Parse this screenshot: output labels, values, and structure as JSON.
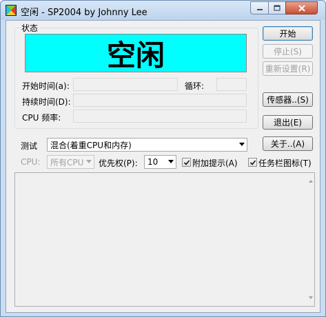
{
  "window": {
    "title": "空闲 - SP2004 by Johnny Lee",
    "min_glyph": "–",
    "max_glyph": "□",
    "close_glyph": "✕"
  },
  "status_group": {
    "label": "状态",
    "status_text": "空闲",
    "status_color": "#00ffff",
    "start_time_label": "开始时间(a):",
    "start_time_value": "",
    "loop_label": "循环:",
    "loop_value": "",
    "duration_label": "持续时间(D):",
    "duration_value": "",
    "cpu_freq_label": "CPU 频率:",
    "cpu_freq_value": ""
  },
  "buttons": {
    "start": "开始",
    "stop": "停止(S)",
    "reset": "重新设置(R)",
    "sensor": "传感器..(S)",
    "exit": "退出(E)",
    "about": "关于..(A)"
  },
  "test": {
    "label": "测试",
    "selected": "混合(着重CPU和内存)"
  },
  "options": {
    "cpu_label": "CPU:",
    "cpu_selected": "所有CPU",
    "priority_label": "优先权(P):",
    "priority_selected": "10",
    "extra_hints_label": "附加提示(A)",
    "extra_hints_checked": true,
    "tray_icon_label": "任务栏图标(T)",
    "tray_icon_checked": true
  },
  "log": {
    "content": ""
  }
}
